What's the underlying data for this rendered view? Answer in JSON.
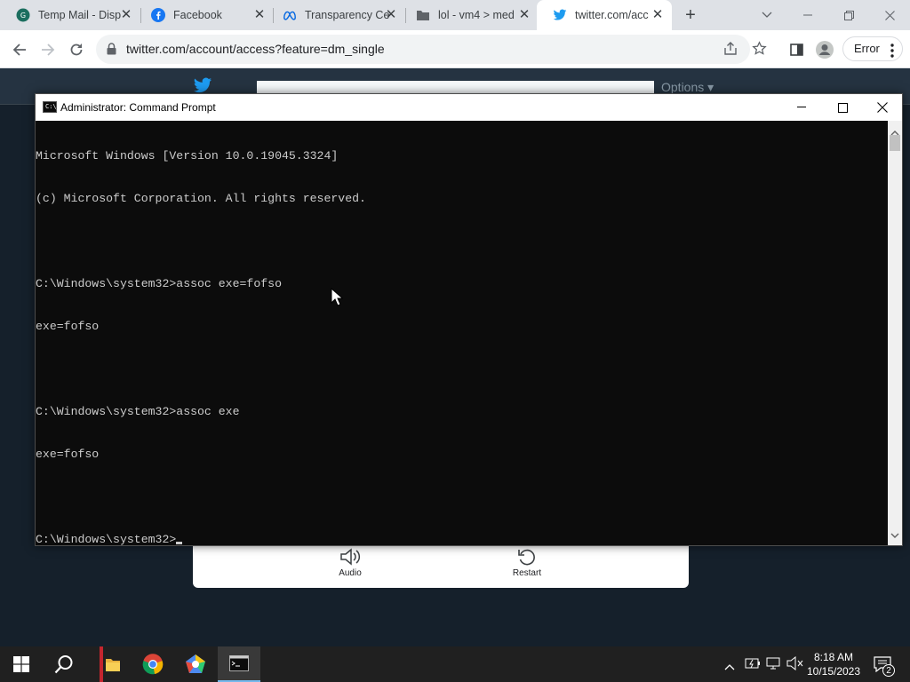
{
  "browser": {
    "tabs": [
      {
        "title": "Temp Mail - Disp",
        "icon": "temp-mail-icon"
      },
      {
        "title": "Facebook",
        "icon": "facebook-icon"
      },
      {
        "title": "Transparency Ce",
        "icon": "meta-icon"
      },
      {
        "title": "lol - vm4 > med",
        "icon": "folder-icon"
      },
      {
        "title": "twitter.com/acc",
        "icon": "twitter-icon",
        "active": true
      }
    ],
    "close_glyph": "✕",
    "new_tab_glyph": "+",
    "url": "twitter.com/account/access?feature=dm_single",
    "error_label": "Error"
  },
  "twitter_page": {
    "options_label": "Options ▾",
    "captcha": {
      "audio_label": "Audio",
      "restart_label": "Restart"
    }
  },
  "cmd": {
    "title": "Administrator: Command Prompt",
    "icon_text": "C:\\_",
    "lines": [
      "Microsoft Windows [Version 10.0.19045.3324]",
      "(c) Microsoft Corporation. All rights reserved.",
      "",
      "C:\\Windows\\system32>assoc exe=fofso",
      "exe=fofso",
      "",
      "C:\\Windows\\system32>assoc exe",
      "exe=fofso",
      "",
      "C:\\Windows\\system32>"
    ]
  },
  "taskbar": {
    "time": "8:18 AM",
    "date": "10/15/2023",
    "notification_count": "2"
  },
  "colors": {
    "tabbar": "#dee1e6",
    "console_bg": "#0c0c0c",
    "console_fg": "#cccccc",
    "taskbar": "#202020",
    "twitter_blue": "#1d9bf0"
  }
}
